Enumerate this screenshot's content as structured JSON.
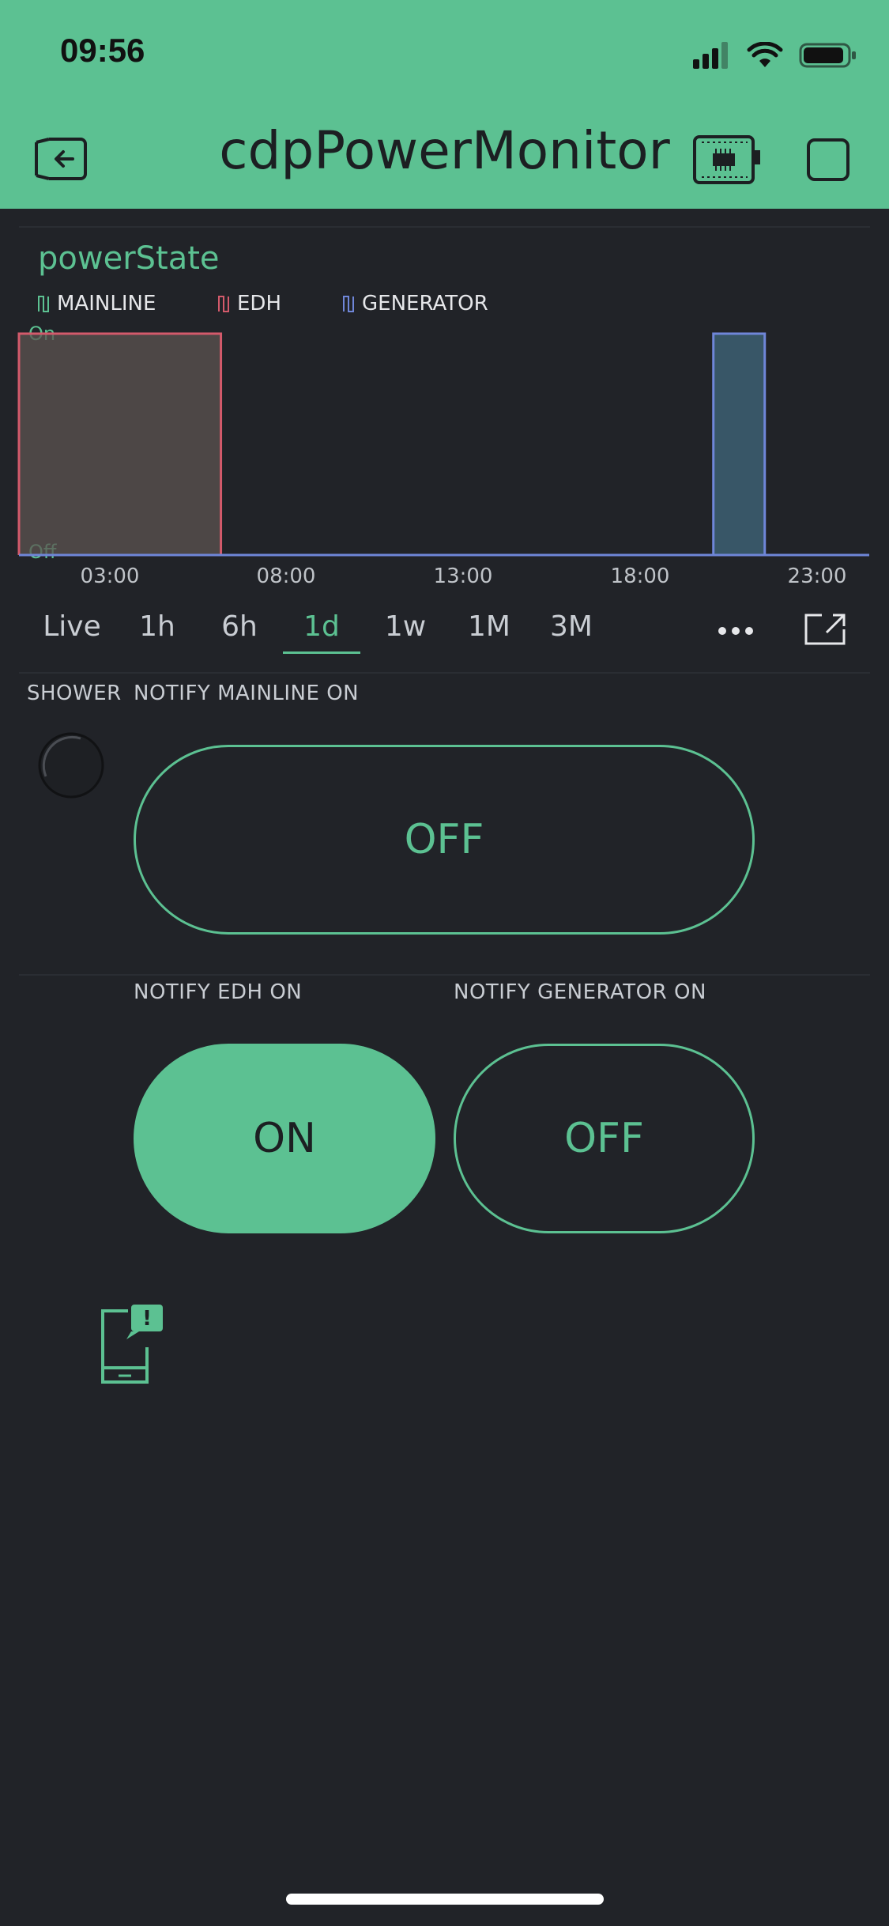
{
  "status_bar": {
    "time": "09:56"
  },
  "app_bar": {
    "title": "cdpPowerMonitor",
    "icons": [
      "exit-project-icon",
      "device-board-icon",
      "stop-square-icon"
    ]
  },
  "chart_data": {
    "type": "area",
    "title": "powerState",
    "xlabel": "",
    "ylabel": "",
    "x_range": [
      0,
      24
    ],
    "x_ticks": [
      "03:00",
      "08:00",
      "13:00",
      "18:00",
      "23:00"
    ],
    "y_ticks": [
      "On",
      "Off"
    ],
    "ylim": [
      0,
      1
    ],
    "legend_position": "top-left",
    "series": [
      {
        "name": "MAINLINE",
        "color": "#5cc192",
        "segments": []
      },
      {
        "name": "EDH",
        "color": "#d35a6b",
        "segments": [
          [
            0.0,
            5.7
          ]
        ]
      },
      {
        "name": "GENERATOR",
        "color": "#6f86d8",
        "segments": [
          [
            19.6,
            21.05
          ]
        ]
      }
    ]
  },
  "time_tabs": {
    "items": [
      "Live",
      "1h",
      "6h",
      "1d",
      "1w",
      "1M",
      "3M"
    ],
    "active": "1d"
  },
  "widgets": {
    "shower_label": "SHOWER",
    "notify_mainline_label": "NOTIFY MAINLINE ON",
    "notify_mainline_value": "OFF",
    "notify_edh_label": "NOTIFY EDH ON",
    "notify_edh_value": "ON",
    "notify_generator_label": "NOTIFY GENERATOR ON",
    "notify_generator_value": "OFF",
    "notification_badge": "!"
  },
  "colors": {
    "accent": "#5cc192",
    "background": "#212328",
    "edh": "#d35a6b",
    "generator": "#6f86d8"
  }
}
